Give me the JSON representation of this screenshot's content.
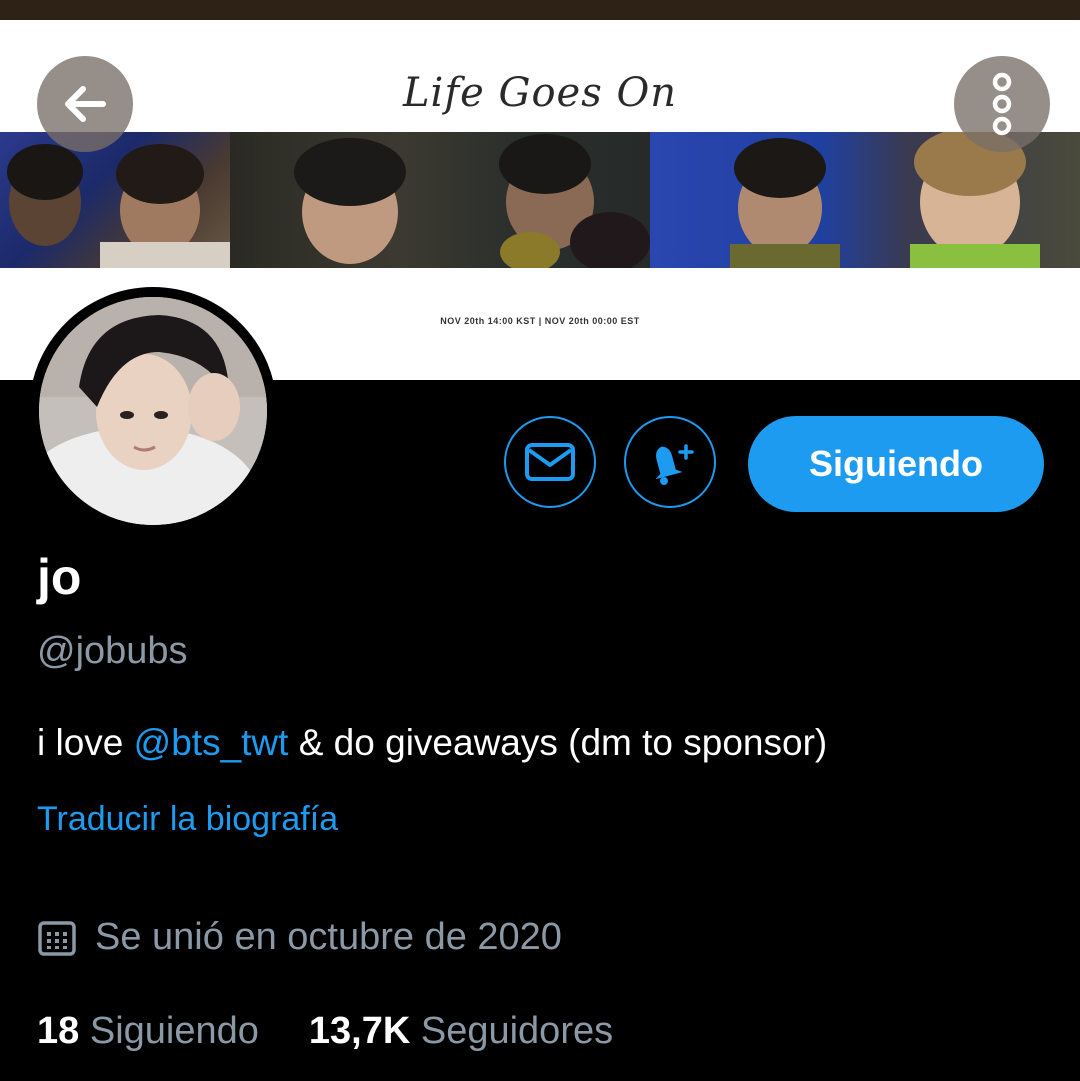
{
  "banner": {
    "title": "Life Goes On",
    "dates": "NOV 20th 14:00 KST | NOV 20th 00:00 EST"
  },
  "header": {
    "back_icon": "arrow-left-icon",
    "more_icon": "more-vertical-icon"
  },
  "actions": {
    "message_icon": "mail-icon",
    "notify_icon": "bell-plus-icon",
    "follow_label": "Siguiendo"
  },
  "profile": {
    "display_name": "jo",
    "handle": "@jobubs",
    "bio_prefix": "i love ",
    "bio_mention": "@bts_twt",
    "bio_suffix": " & do giveaways (dm to sponsor)",
    "translate_label": "Traducir la biografía",
    "joined_icon": "calendar-icon",
    "joined_text": "Se unió en octubre de 2020",
    "following_count": "18",
    "following_label": "Siguiendo",
    "followers_count": "13,7K",
    "followers_label": "Seguidores"
  },
  "colors": {
    "accent": "#1d9bf0",
    "background": "#000000",
    "secondary_text": "#8b98a5"
  }
}
